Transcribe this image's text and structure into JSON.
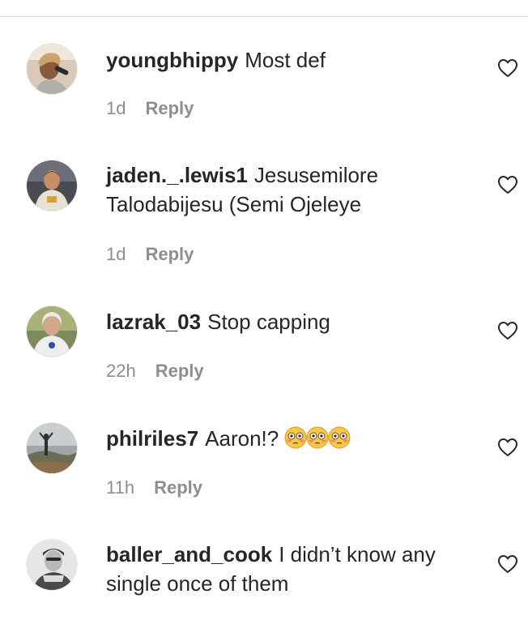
{
  "comments": [
    {
      "username": "youngbhippy",
      "text": "Most def",
      "time": "1d",
      "reply_label": "Reply",
      "like_icon": "heart-outline-icon"
    },
    {
      "username": "jaden._.lewis1",
      "text": "Jesusemilore Talodabijesu (Semi Ojeleye",
      "time": "1d",
      "reply_label": "Reply",
      "like_icon": "heart-outline-icon"
    },
    {
      "username": "lazrak_03",
      "text": "Stop capping",
      "time": "22h",
      "reply_label": "Reply",
      "like_icon": "heart-outline-icon"
    },
    {
      "username": "philriles7",
      "text": "Aaron!?",
      "emoji": "flushed-face-emoji x3",
      "time": "11h",
      "reply_label": "Reply",
      "like_icon": "heart-outline-icon"
    },
    {
      "username": "baller_and_cook",
      "text": "I didn’t know any single once of them",
      "like_icon": "heart-outline-icon"
    }
  ]
}
